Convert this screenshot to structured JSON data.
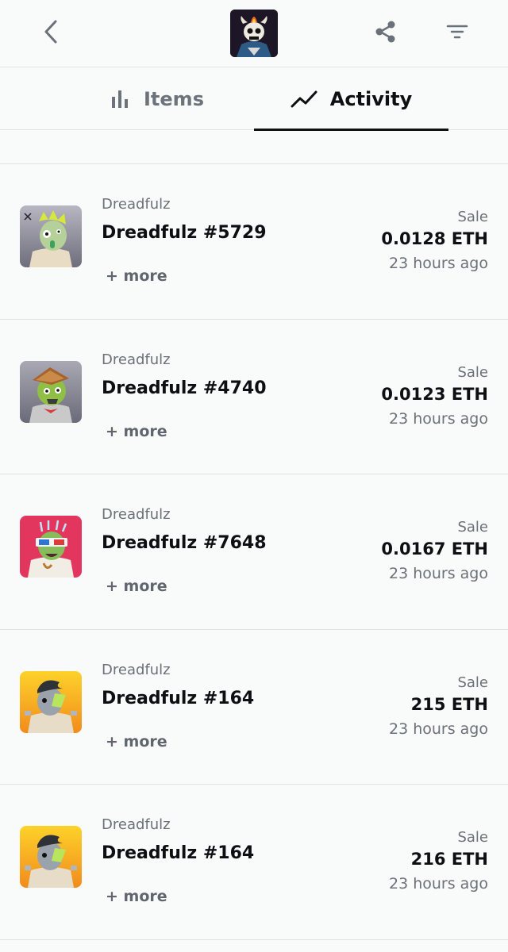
{
  "header": {
    "back_icon": "chevron-left-icon",
    "collection_avatar": "skull-character-avatar",
    "share_icon": "share-icon",
    "filter_icon": "filter-icon"
  },
  "tabs": [
    {
      "label": "Items",
      "icon": "bar-chart-icon",
      "active": false
    },
    {
      "label": "Activity",
      "icon": "trend-line-icon",
      "active": true
    }
  ],
  "activity": [
    {
      "collection": "Dreadfulz",
      "name": "Dreadfulz #5729",
      "more": "+ more",
      "event": "Sale",
      "price": "0.0128 ETH",
      "time": "23 hours ago",
      "thumb_bg": "#9a99a6"
    },
    {
      "collection": "Dreadfulz",
      "name": "Dreadfulz #4740",
      "more": "+ more",
      "event": "Sale",
      "price": "0.0123 ETH",
      "time": "23 hours ago",
      "thumb_bg": "#8b8a97"
    },
    {
      "collection": "Dreadfulz",
      "name": "Dreadfulz #7648",
      "more": "+ more",
      "event": "Sale",
      "price": "0.0167 ETH",
      "time": "23 hours ago",
      "thumb_bg": "#e3365f"
    },
    {
      "collection": "Dreadfulz",
      "name": "Dreadfulz #164",
      "more": "+ more",
      "event": "Sale",
      "price": "215 ETH",
      "time": "23 hours ago",
      "thumb_bg": "#f6b21b"
    },
    {
      "collection": "Dreadfulz",
      "name": "Dreadfulz #164",
      "more": "+ more",
      "event": "Sale",
      "price": "216 ETH",
      "time": "23 hours ago",
      "thumb_bg": "#f6b21b"
    }
  ]
}
